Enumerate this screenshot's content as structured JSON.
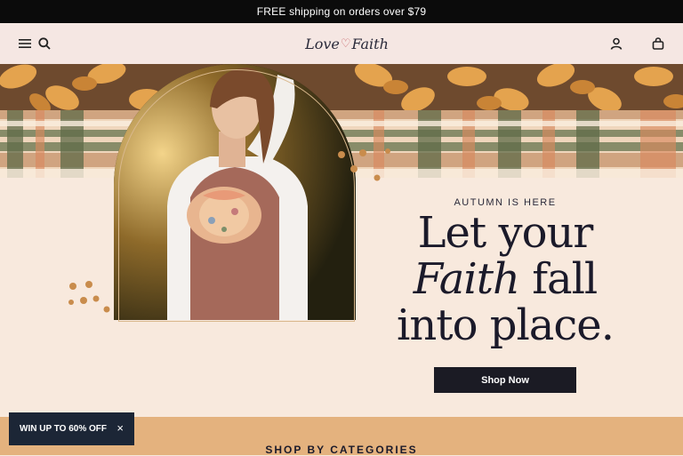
{
  "announcement": {
    "text": "FREE shipping on orders over $79"
  },
  "header": {
    "menu_icon": "menu-icon",
    "search_icon": "search-icon",
    "logo": {
      "part1": "Love",
      "part2": "Faith"
    },
    "account_icon": "user-icon",
    "cart_icon": "bag-icon"
  },
  "hero": {
    "eyebrow": "AUTUMN IS HERE",
    "headline": {
      "line1": "Let your",
      "line2_em": "Faith",
      "line2_rest": " fall",
      "line3": "into place."
    },
    "cta_label": "Shop Now"
  },
  "categories": {
    "title": "SHOP BY CATEGORIES"
  },
  "promo": {
    "label": "WIN UP TO 60% OFF",
    "close_label": "×"
  },
  "colors": {
    "announce_bg": "#0b0b0b",
    "header_bg": "#f5e7e3",
    "hero_bg": "#f8e9dd",
    "cta_bg": "#1b1b24",
    "promo_bg": "#1c2636",
    "categories_bg": "#e4b27e"
  }
}
